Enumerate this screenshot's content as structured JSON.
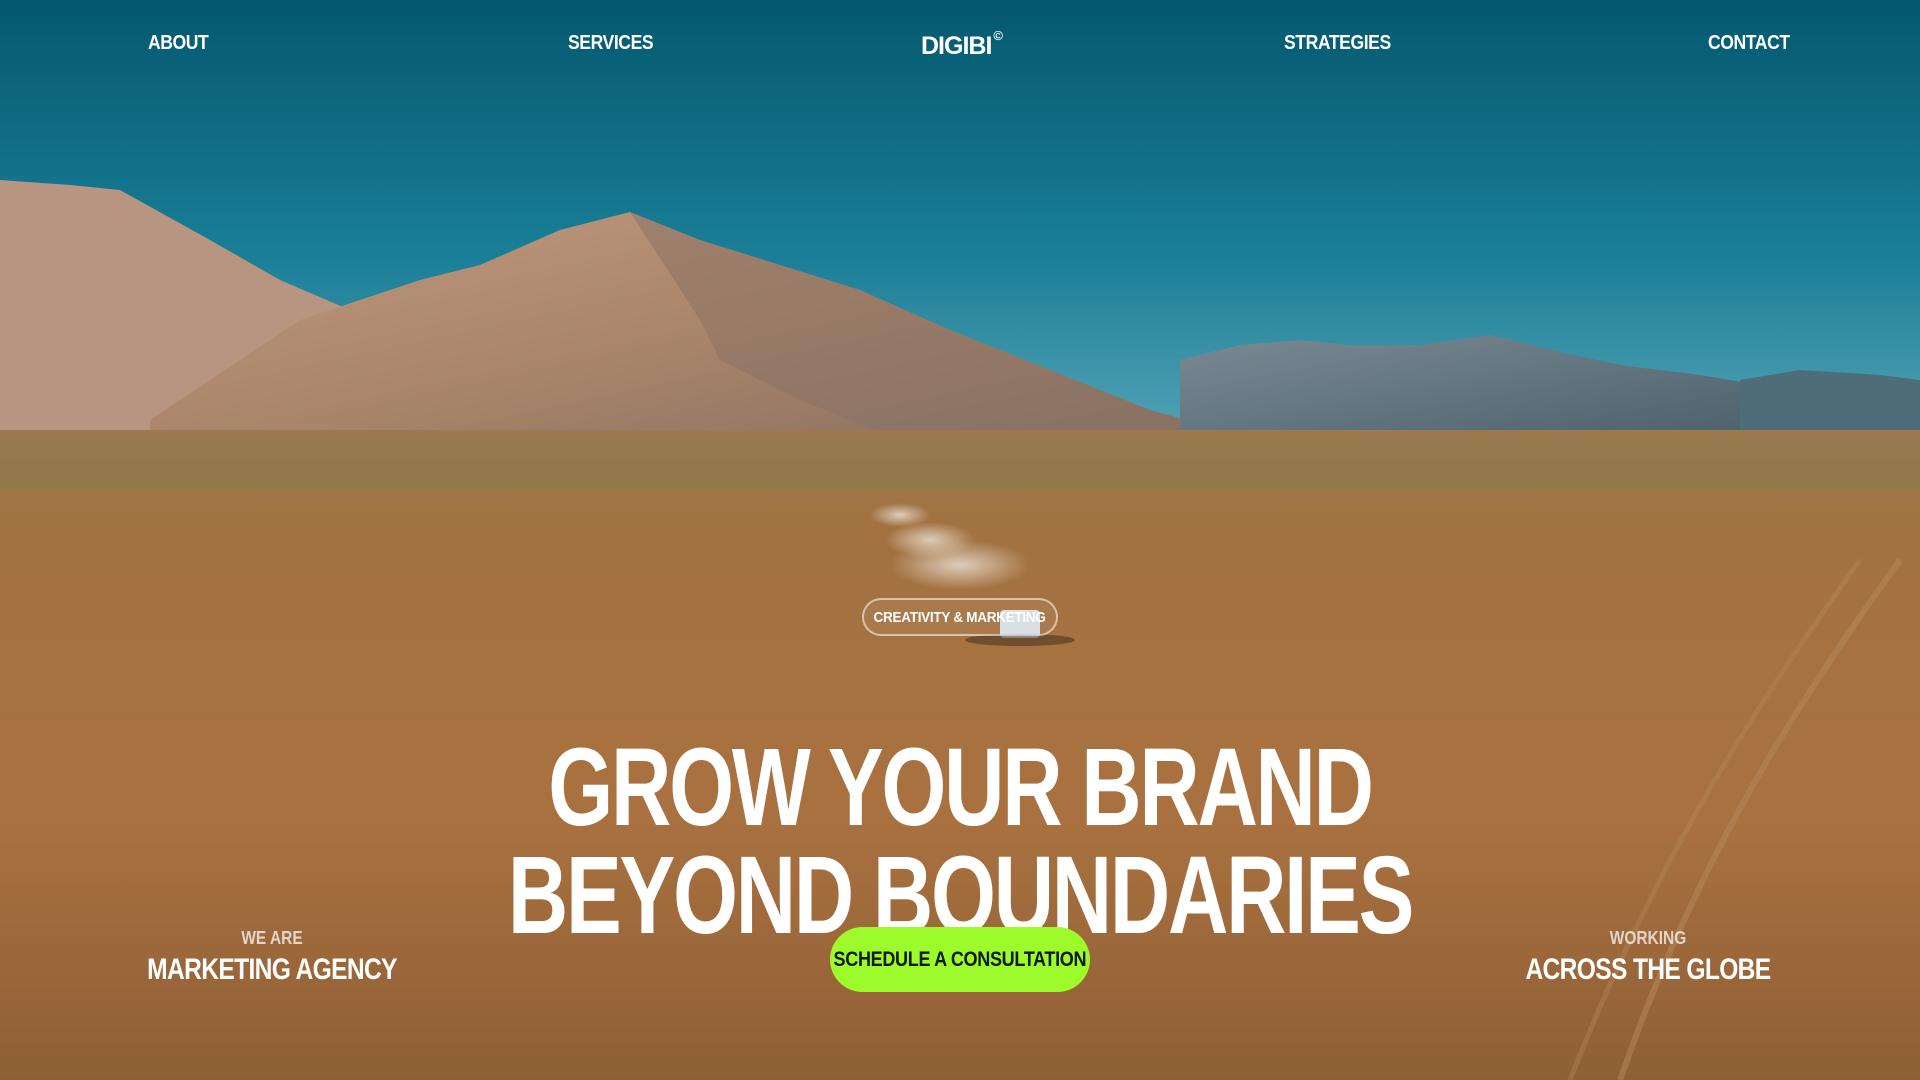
{
  "nav": {
    "items": [
      {
        "label": "ABOUT"
      },
      {
        "label": "SERVICES"
      },
      {
        "label": "STRATEGIES"
      },
      {
        "label": "CONTACT"
      }
    ],
    "logo": {
      "text": "DIGIBI",
      "mark": "©"
    }
  },
  "hero": {
    "tag": "CREATIVITY & MARKETING",
    "headline_line1": "GROW YOUR BRAND",
    "headline_line2": "BEYOND BOUNDARIES",
    "cta_label": "SCHEDULE A CONSULTATION",
    "left_kicker": "WE ARE",
    "left_main": "MARKETING AGENCY",
    "right_kicker": "WORKING",
    "right_main": "ACROSS THE GLOBE"
  },
  "colors": {
    "sky_top": "#055a73",
    "cta_green": "#9dfa2b",
    "desert": "#a8764a"
  }
}
